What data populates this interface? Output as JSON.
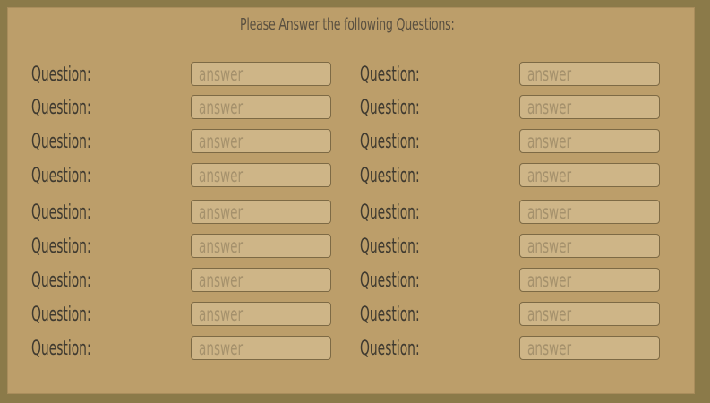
{
  "form": {
    "title": "Please Answer the following Questions:",
    "question_label": "Question:",
    "answer_placeholder": "answer",
    "rows": 9,
    "columns": 2
  },
  "colors": {
    "background_outer": "#8b7a49",
    "panel": "#bc9e6a",
    "input_fill": "#ceb587",
    "input_border": "#7d6a45",
    "label_text": "#3f3a30",
    "placeholder_text": "#a5916c"
  }
}
